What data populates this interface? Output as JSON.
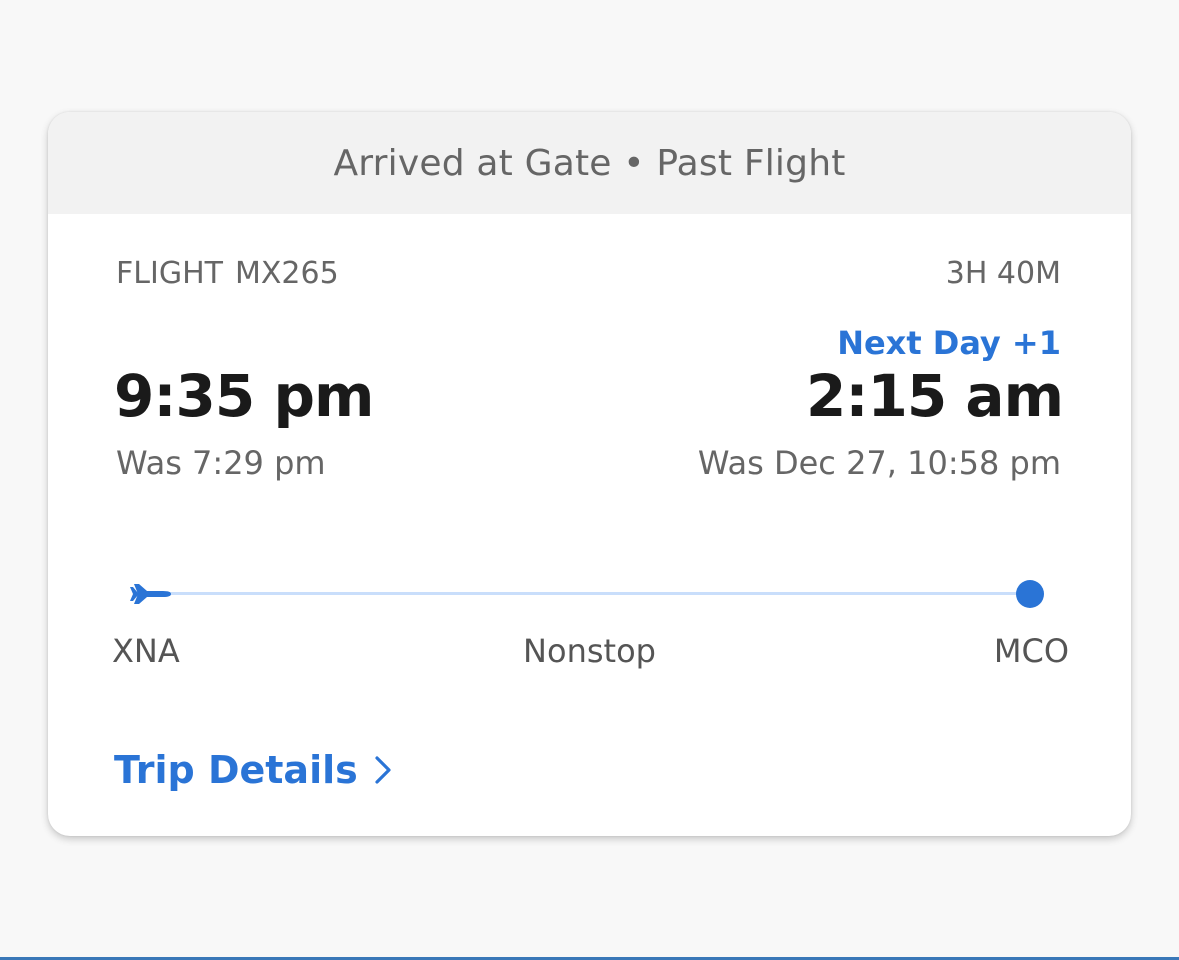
{
  "card": {
    "status": "Arrived at Gate • Past Flight",
    "flight_label": "FLIGHT",
    "flight_number": "MX265",
    "duration": "3H 40M",
    "next_day": "Next Day +1",
    "departure": {
      "time": "9:35 pm",
      "was": "Was 7:29 pm",
      "airport": "XNA"
    },
    "arrival": {
      "time": "2:15 am",
      "was": "Was Dec 27, 10:58 pm",
      "airport": "MCO"
    },
    "stops": "Nonstop",
    "trip_details_label": "Trip Details"
  },
  "icons": {
    "departure": "airplane-icon",
    "arrival": "destination-dot-icon",
    "link": "chevron-right-icon"
  },
  "colors": {
    "accent": "#2a74d6",
    "route_line": "#c9defb",
    "header_bg": "#f2f2f2",
    "page_bg": "#f8f8f8"
  }
}
